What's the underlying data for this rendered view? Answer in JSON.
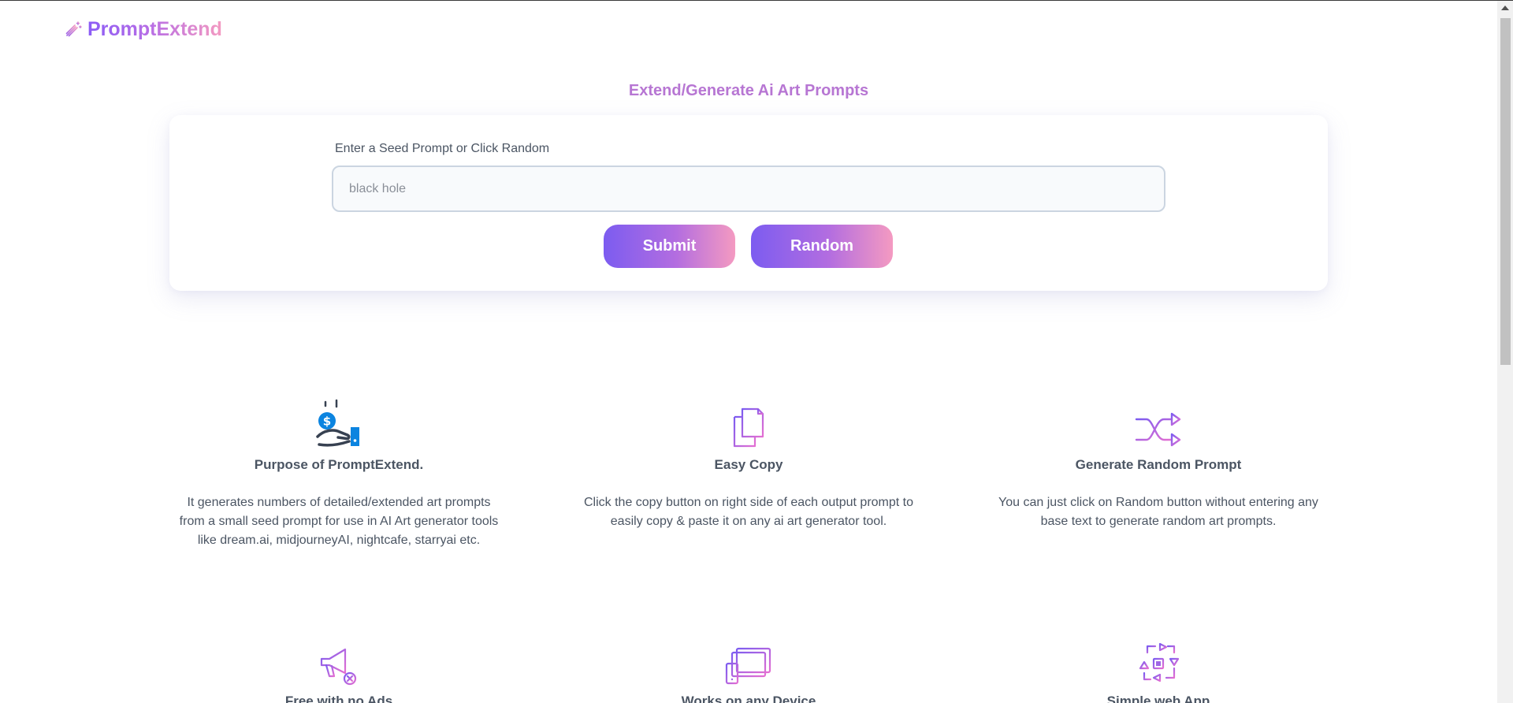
{
  "brand": {
    "name": "PromptExtend",
    "icon": "magic-wand-icon",
    "gradient_start": "#8b5cf6",
    "gradient_end": "#f49ac1"
  },
  "hero": {
    "title": "Extend/Generate Ai Art Prompts",
    "seed_label": "Enter a Seed Prompt or Click Random",
    "seed_placeholder": "black hole",
    "submit_label": "Submit",
    "random_label": "Random"
  },
  "features": [
    {
      "icon": "hand-money-icon",
      "title": "Purpose of PromptExtend.",
      "description": "It generates numbers of detailed/extended art prompts from a small seed prompt for use in AI Art generator tools like dream.ai, midjourneyAI, nightcafe, starryai etc."
    },
    {
      "icon": "copy-documents-icon",
      "title": "Easy Copy",
      "description": "Click the copy button on right side of each output prompt to easily copy & paste it on any ai art generator tool."
    },
    {
      "icon": "shuffle-icon",
      "title": "Generate Random Prompt",
      "description": "You can just click on Random button without entering any base text to generate random art prompts."
    },
    {
      "icon": "megaphone-no-ads-icon",
      "title": "Free with no Ads",
      "description": ""
    },
    {
      "icon": "devices-icon",
      "title": "Works on any Device",
      "description": ""
    },
    {
      "icon": "web-app-flow-icon",
      "title": "Simple web App",
      "description": ""
    }
  ],
  "colors": {
    "accent_purple": "#8b5cf6",
    "accent_pink": "#f49ac1",
    "title_purple": "#b776d3",
    "text_gray": "#4b5563"
  }
}
